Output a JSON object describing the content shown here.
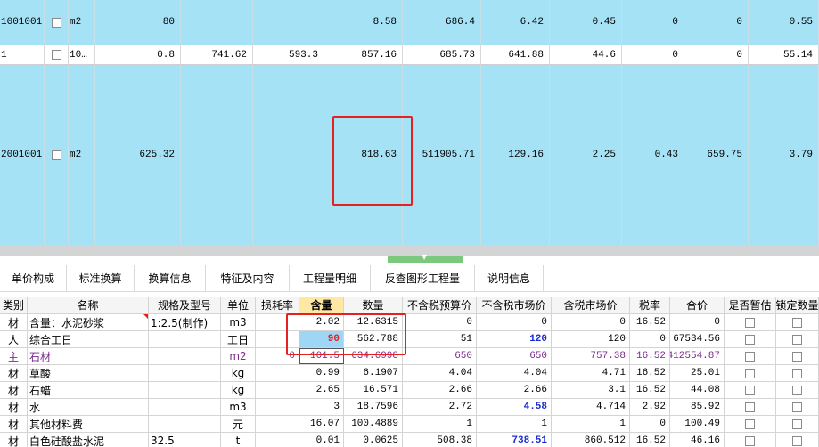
{
  "top_rows": [
    [
      "1001001",
      "",
      "m2",
      "80",
      "",
      "",
      "8.58",
      "686.4",
      "6.42",
      "0.45",
      "0",
      "0",
      "0.55"
    ],
    [
      "1",
      "",
      "10…",
      "0.8",
      "741.62",
      "593.3",
      "857.16",
      "685.73",
      "641.88",
      "44.6",
      "0",
      "0",
      "55.14"
    ],
    [
      "2001001",
      "",
      "m2",
      "625.32",
      "",
      "",
      "818.63",
      "511905.71",
      "129.16",
      "2.25",
      "0.43",
      "659.75",
      "3.79"
    ]
  ],
  "tabs": [
    "单价构成",
    "标准换算",
    "换算信息",
    "特征及内容",
    "工程量明细",
    "反查图形工程量",
    "说明信息"
  ],
  "headers": [
    "类别",
    "名称",
    "规格及型号",
    "单位",
    "损耗率",
    "含量",
    "数量",
    "不含税预算价",
    "不含税市场价",
    "含税市场价",
    "税率",
    "合价",
    "是否暂估",
    "锁定数量"
  ],
  "rows": [
    [
      "材",
      "含量：水泥砂浆",
      "1:2.5(制作)",
      "m3",
      "",
      "2.02",
      "12.6315",
      "0",
      "0",
      "0",
      "16.52",
      "0"
    ],
    [
      "人",
      "综合工日",
      "",
      "工日",
      "",
      "90",
      "562.788",
      "51",
      "120",
      "120",
      "0",
      "67534.56"
    ],
    [
      "主",
      "石材",
      "",
      "m2",
      "0",
      "101.5",
      "634.6998",
      "650",
      "650",
      "757.38",
      "16.52",
      "412554.87"
    ],
    [
      "材",
      "草酸",
      "",
      "kg",
      "",
      "0.99",
      "6.1907",
      "4.04",
      "4.04",
      "4.71",
      "16.52",
      "25.01"
    ],
    [
      "材",
      "石蜡",
      "",
      "kg",
      "",
      "2.65",
      "16.571",
      "2.66",
      "2.66",
      "3.1",
      "16.52",
      "44.08"
    ],
    [
      "材",
      "水",
      "",
      "m3",
      "",
      "3",
      "18.7596",
      "2.72",
      "4.58",
      "4.714",
      "2.92",
      "85.92"
    ],
    [
      "材",
      "其他材料费",
      "",
      "元",
      "",
      "16.07",
      "100.4889",
      "1",
      "1",
      "1",
      "0",
      "100.49"
    ],
    [
      "材",
      "白色硅酸盐水泥",
      "32.5",
      "t",
      "",
      "0.01",
      "0.0625",
      "508.38",
      "738.51",
      "860.512",
      "16.52",
      "46.16"
    ]
  ]
}
